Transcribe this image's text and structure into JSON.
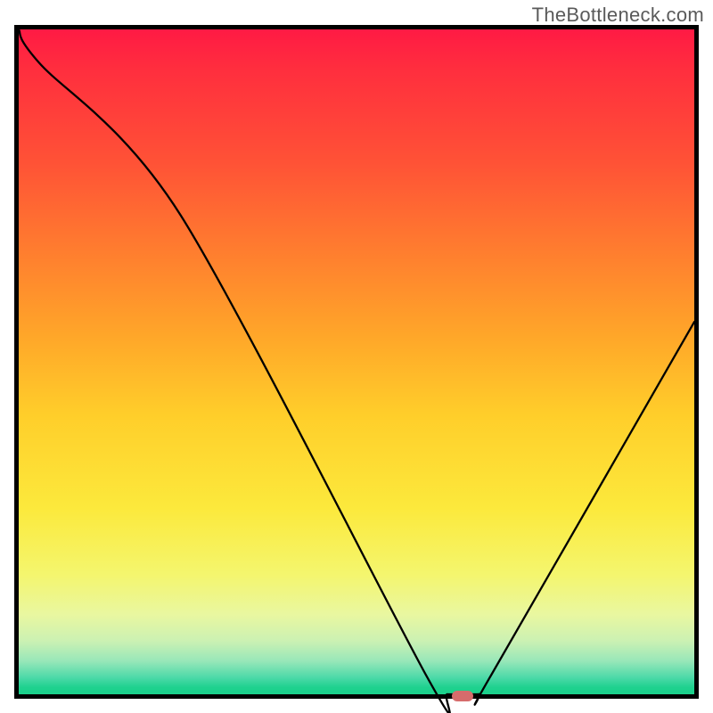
{
  "watermark": "TheBottleneck.com",
  "chart_data": {
    "type": "line",
    "title": "",
    "xlabel": "",
    "ylabel": "",
    "xlim": [
      0,
      100
    ],
    "ylim": [
      0,
      100
    ],
    "x": [
      0,
      3,
      24,
      60.5,
      63.5,
      68,
      70,
      100
    ],
    "y": [
      100,
      95,
      72,
      2.5,
      0,
      0,
      3,
      56
    ],
    "annotations": [
      {
        "label": "minimum-marker",
        "x": 65.5,
        "y": 0
      }
    ]
  },
  "marker": {
    "x_pct": 65.5,
    "y_pct": 0,
    "color": "#d66c6c"
  }
}
